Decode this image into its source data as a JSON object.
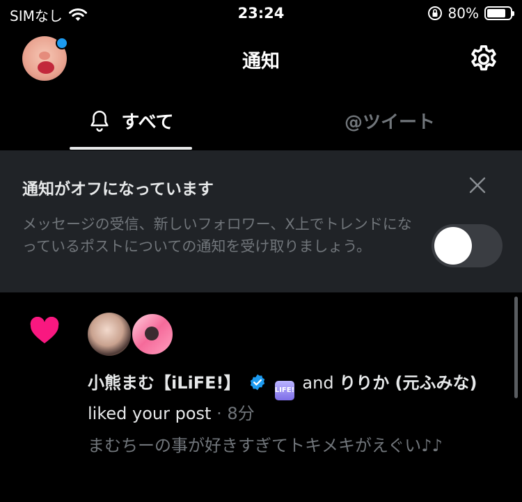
{
  "status_bar": {
    "carrier": "SIMなし",
    "time": "23:24",
    "battery_percent": "80%",
    "battery_level": 0.8
  },
  "header": {
    "title": "通知"
  },
  "tabs": [
    {
      "label": "すべて",
      "selected": true
    },
    {
      "label": "@ツイート",
      "selected": false
    }
  ],
  "banner": {
    "title": "通知がオフになっています",
    "body": "メッセージの受信、新しいフォロワー、X上でトレンドになっているポストについての通知を受け取りましょう。",
    "toggle_on": false
  },
  "notification": {
    "user1": "小熊まむ【iLiFE!】",
    "badge_text": "LIFE!",
    "and": "and",
    "user2": "りりか (元ふみな)",
    "action": "liked your post",
    "separator": "·",
    "time": "8分",
    "quote": "まむちーの事が好きすぎてトキメキがえぐい♪♪"
  },
  "colors": {
    "accent": "#1d9bf0",
    "like": "#f91880",
    "banner_bg": "#202327",
    "muted": "#71767b"
  }
}
